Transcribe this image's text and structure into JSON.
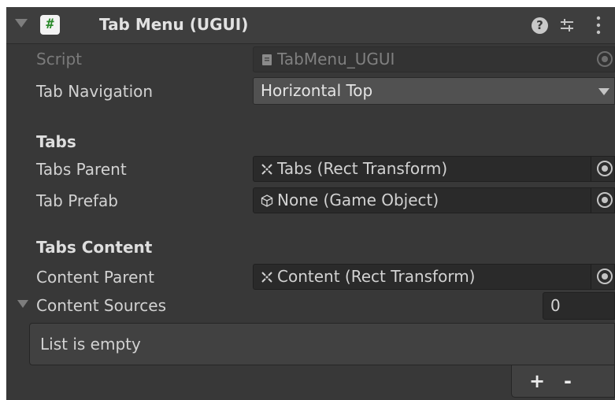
{
  "header": {
    "title": "Tab Menu (UGUI)",
    "script_icon_glyph": "#",
    "help_glyph": "?",
    "icons": [
      "foldout-arrow-icon",
      "csharp-script-icon",
      "help-icon",
      "presets-icon",
      "context-menu-icon"
    ]
  },
  "fields": {
    "script": {
      "label": "Script",
      "value": "TabMenu_UGUI",
      "icon": "script-file-icon"
    },
    "tab_navigation": {
      "label": "Tab Navigation",
      "value": "Horizontal Top"
    },
    "tabs_section": "Tabs",
    "tabs_parent": {
      "label": "Tabs Parent",
      "value": "Tabs (Rect Transform)",
      "icon": "rect-transform-icon"
    },
    "tab_prefab": {
      "label": "Tab Prefab",
      "value": "None (Game Object)",
      "icon": "game-object-icon"
    },
    "tabs_content_section": "Tabs Content",
    "content_parent": {
      "label": "Content Parent",
      "value": "Content (Rect Transform)",
      "icon": "rect-transform-icon"
    }
  },
  "list": {
    "label": "Content Sources",
    "size": "0",
    "empty_text": "List is empty",
    "add_label": "+",
    "remove_label": "-"
  },
  "colors": {
    "panel": "#383838",
    "header": "#3e3e3e",
    "field": "#2a2a2a",
    "dropdown": "#515151",
    "text": "#d2d2d2",
    "disabled_text": "#7b7b7b"
  }
}
